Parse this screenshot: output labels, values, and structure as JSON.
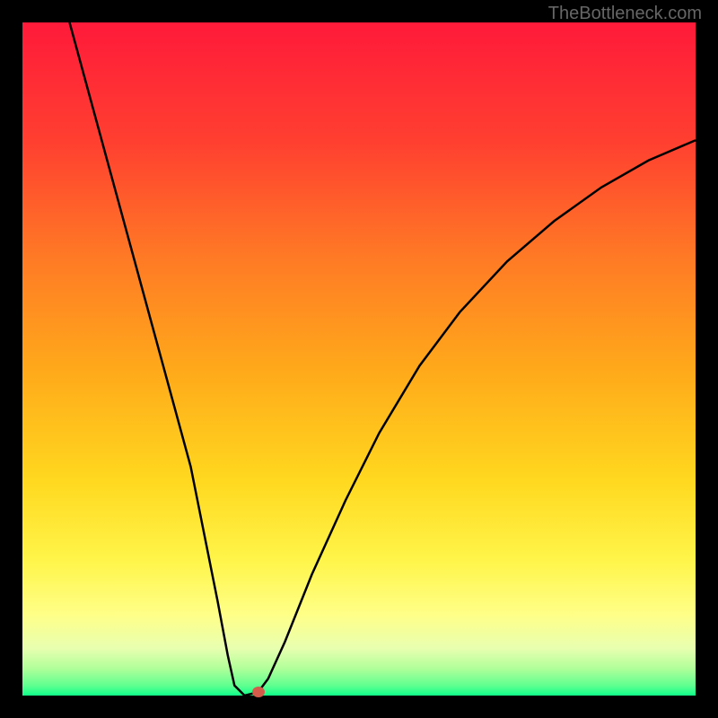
{
  "watermark": "TheBottleneck.com",
  "chart_data": {
    "type": "line",
    "title": "",
    "xlabel": "",
    "ylabel": "",
    "xlim": [
      0,
      100
    ],
    "ylim": [
      0,
      100
    ],
    "gradient_colors": {
      "top": "#ff1a3a",
      "upper_mid": "#ff6a2a",
      "mid": "#ffaa1a",
      "lower_mid": "#ffe01f",
      "lower": "#ffff66",
      "near_bottom": "#c8ff7a",
      "bottom": "#0fff8a"
    },
    "curve_points": [
      {
        "x": 7.0,
        "y": 100.0
      },
      {
        "x": 10.0,
        "y": 89.0
      },
      {
        "x": 13.0,
        "y": 78.0
      },
      {
        "x": 16.0,
        "y": 67.0
      },
      {
        "x": 19.0,
        "y": 56.0
      },
      {
        "x": 22.0,
        "y": 45.0
      },
      {
        "x": 25.0,
        "y": 34.0
      },
      {
        "x": 27.0,
        "y": 24.0
      },
      {
        "x": 29.0,
        "y": 14.0
      },
      {
        "x": 30.5,
        "y": 6.0
      },
      {
        "x": 31.5,
        "y": 1.5
      },
      {
        "x": 33.0,
        "y": 0.0
      },
      {
        "x": 35.0,
        "y": 0.5
      },
      {
        "x": 36.5,
        "y": 2.5
      },
      {
        "x": 39.0,
        "y": 8.0
      },
      {
        "x": 43.0,
        "y": 18.0
      },
      {
        "x": 48.0,
        "y": 29.0
      },
      {
        "x": 53.0,
        "y": 39.0
      },
      {
        "x": 59.0,
        "y": 49.0
      },
      {
        "x": 65.0,
        "y": 57.0
      },
      {
        "x": 72.0,
        "y": 64.5
      },
      {
        "x": 79.0,
        "y": 70.5
      },
      {
        "x": 86.0,
        "y": 75.5
      },
      {
        "x": 93.0,
        "y": 79.5
      },
      {
        "x": 100.0,
        "y": 82.5
      }
    ],
    "marker": {
      "x": 35.0,
      "y": 0.5,
      "color": "#d45a4a"
    }
  }
}
